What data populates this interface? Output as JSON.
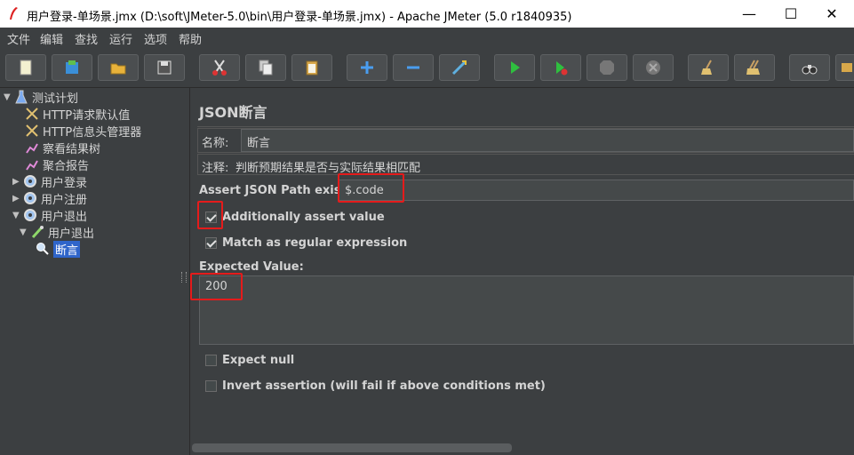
{
  "window": {
    "title": "用户登录-单场景.jmx (D:\\soft\\JMeter-5.0\\bin\\用户登录-单场景.jmx) - Apache JMeter (5.0 r1840935)",
    "minimize": "—",
    "maximize": "☐",
    "close": "✕"
  },
  "menu": [
    "文件",
    "编辑",
    "查找",
    "运行",
    "选项",
    "帮助"
  ],
  "toolbar": {
    "buttons": [
      "new-icon",
      "templates-icon",
      "open-icon",
      "save-icon",
      "cut-icon",
      "copy-icon",
      "paste-icon",
      "expand-icon",
      "collapse-icon",
      "toggle-icon",
      "start-icon",
      "start-no-pause-icon",
      "stop-icon",
      "shutdown-icon",
      "clear-icon",
      "clear-all-icon",
      "search-icon",
      "reset-search-icon"
    ]
  },
  "tree": {
    "items": [
      {
        "label": "测试计划"
      },
      {
        "label": "HTTP请求默认值"
      },
      {
        "label": "HTTP信息头管理器"
      },
      {
        "label": "察看结果树"
      },
      {
        "label": "聚合报告"
      },
      {
        "label": "用户登录"
      },
      {
        "label": "用户注册"
      },
      {
        "label": "用户退出"
      },
      {
        "label": "用户退出"
      },
      {
        "label": "断言"
      }
    ]
  },
  "panel": {
    "title": "JSON断言",
    "name_label": "名称:",
    "name_value": "断言",
    "comment_label": "注释:",
    "comment_value": "判断预期结果是否与实际结果相匹配",
    "path_label": "Assert JSON Path exists:",
    "path_value": "$.code",
    "additionally_assert_label": "Additionally assert value",
    "additionally_assert_checked": true,
    "regex_label": "Match as regular expression",
    "regex_checked": true,
    "expected_label": "Expected Value:",
    "expected_value": "200",
    "expect_null_label": "Expect null",
    "expect_null_checked": false,
    "invert_label": "Invert assertion (will fail if above conditions met)",
    "invert_checked": false
  },
  "colors": {
    "background": "#3c3f41",
    "selection": "#2f65ca",
    "highlight": "#e51b1b"
  }
}
